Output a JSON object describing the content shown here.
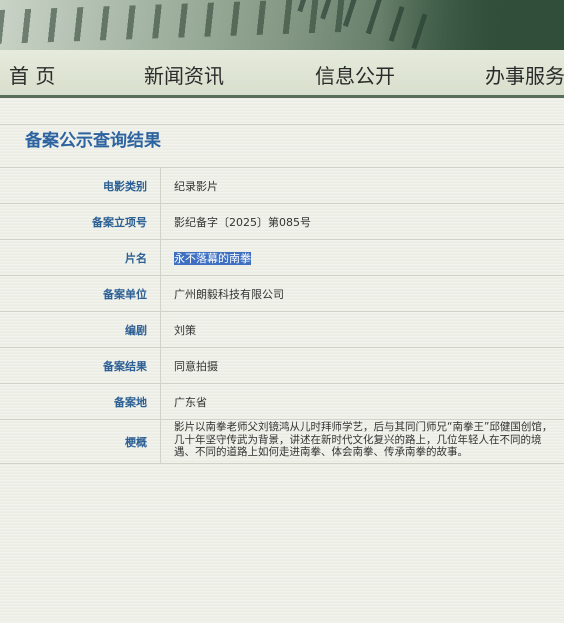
{
  "nav": {
    "items": [
      {
        "label": "首 页"
      },
      {
        "label": "新闻资讯"
      },
      {
        "label": "信息公开"
      },
      {
        "label": "办事服务"
      }
    ]
  },
  "section": {
    "title": "备案公示查询结果"
  },
  "records": {
    "type_label": "电影类别",
    "type_value": "纪录影片",
    "number_label": "备案立项号",
    "number_value": "影纪备字〔2025〕第085号",
    "title_label": "片名",
    "title_value": "永不落幕的南拳",
    "company_label": "备案单位",
    "company_value": "广州朗毅科技有限公司",
    "writer_label": "编剧",
    "writer_value": "刘策",
    "result_label": "备案结果",
    "result_value": "同意拍摄",
    "place_label": "备案地",
    "place_value": "广东省",
    "summary_label": "梗概",
    "summary_value": "影片以南拳老师父刘镜鸿从儿时拜师学艺，后与其同门师兄“南拳王”邱健国创馆，几十年坚守传武为背景，讲述在新时代文化复兴的路上，几位年轻人在不同的境遇、不同的道路上如何走进南拳、体会南拳、传承南拳的故事。"
  },
  "colors": {
    "label_blue": "#2c5f94",
    "title_blue": "#2c63a0",
    "nav_border": "#566e5a",
    "selection": "#3e6fc1"
  }
}
